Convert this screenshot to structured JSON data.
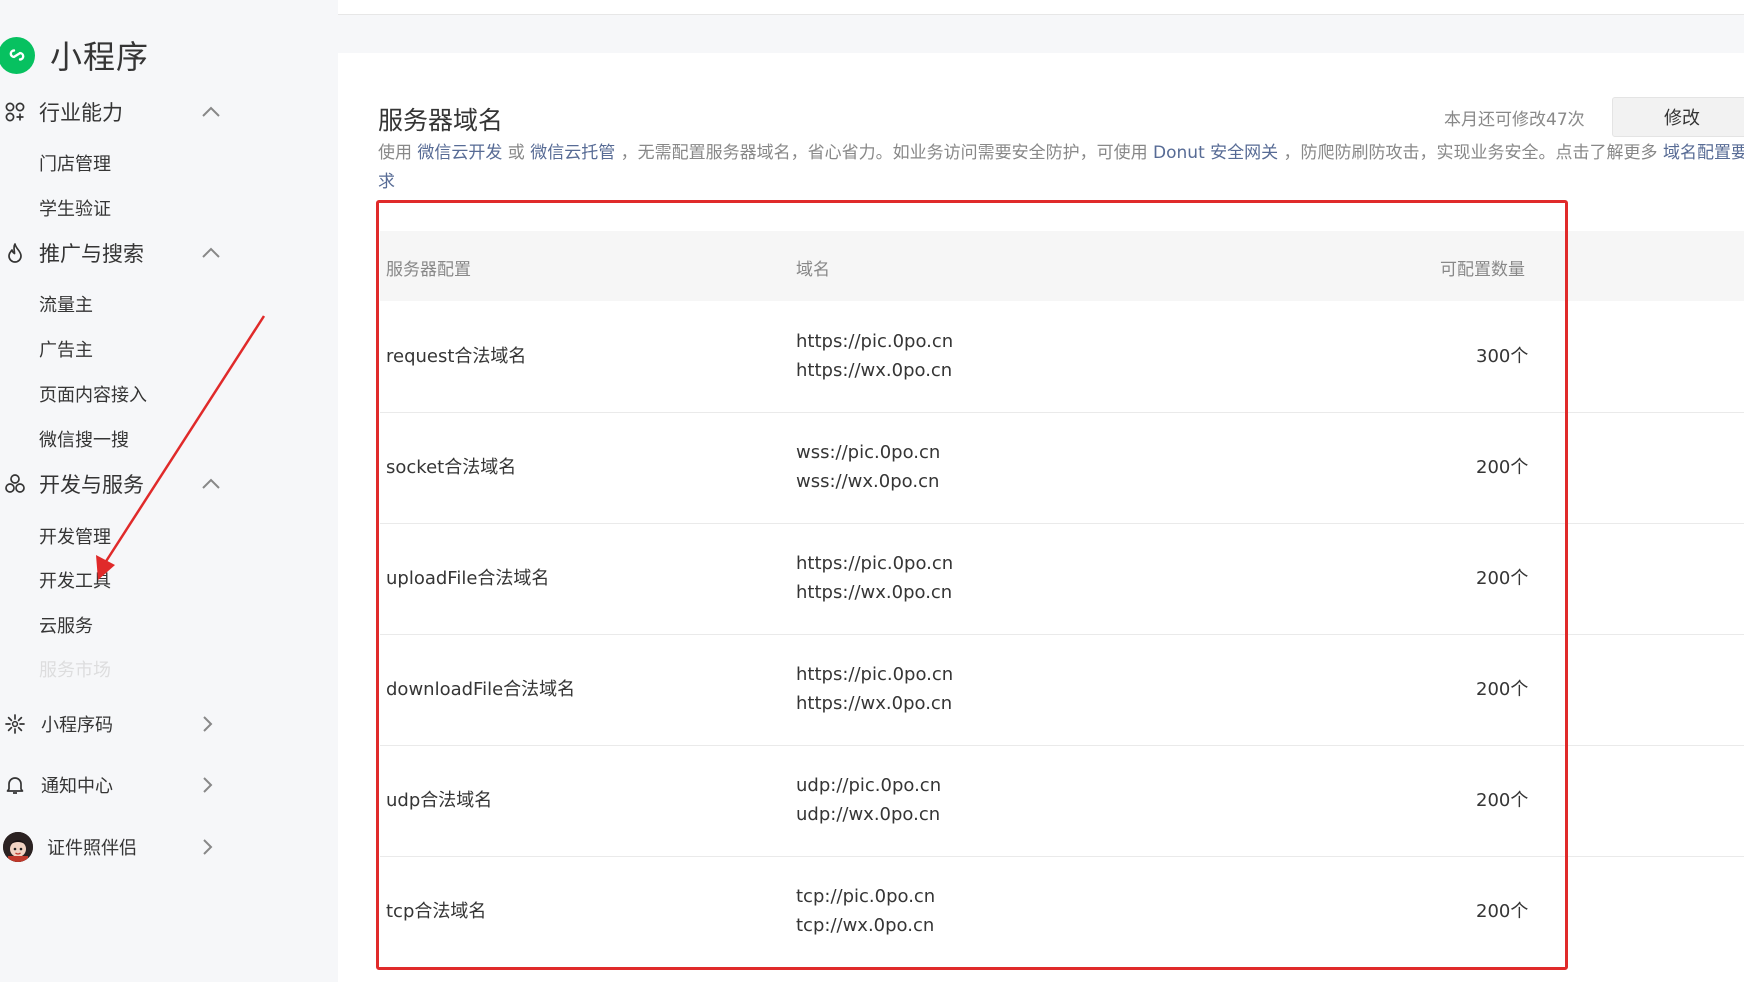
{
  "app": {
    "title": "小程序",
    "brand_color": "#07c160"
  },
  "sidebar": {
    "groups": [
      {
        "icon": "industry-icon",
        "label": "行业能力",
        "expanded": true,
        "items": [
          "门店管理",
          "学生验证"
        ]
      },
      {
        "icon": "flame-icon",
        "label": "推广与搜索",
        "expanded": true,
        "items": [
          "流量主",
          "广告主",
          "页面内容接入",
          "微信搜一搜"
        ]
      },
      {
        "icon": "dev-services-icon",
        "label": "开发与服务",
        "expanded": true,
        "items": [
          "开发管理",
          "开发工具",
          "云服务",
          "服务市场"
        ]
      }
    ],
    "links": [
      {
        "icon": "qrcode-icon",
        "label": "小程序码"
      },
      {
        "icon": "bell-icon",
        "label": "通知中心"
      },
      {
        "icon": "avatar",
        "label": "证件照伴侣"
      }
    ]
  },
  "main": {
    "title": "服务器域名",
    "quota_text": "本月还可修改47次",
    "edit_button": "修改",
    "desc": {
      "p1": "使用 ",
      "link1": "微信云开发",
      "p2": " 或 ",
      "link2": "微信云托管",
      "p3": " ，无需配置服务器域名，省心省力。如业务访问需要安全防护，可使用 ",
      "link3": "Donut 安全网关",
      "p4": " ，防爬防刷防攻击，实现业务安全。点击了解更多 ",
      "link4": "域名配置要求"
    },
    "table": {
      "headers": [
        "服务器配置",
        "域名",
        "可配置数量"
      ],
      "rows": [
        {
          "config": "request合法域名",
          "domains": [
            "https://pic.0po.cn",
            "https://wx.0po.cn"
          ],
          "count": "300个"
        },
        {
          "config": "socket合法域名",
          "domains": [
            "wss://pic.0po.cn",
            "wss://wx.0po.cn"
          ],
          "count": "200个"
        },
        {
          "config": "uploadFile合法域名",
          "domains": [
            "https://pic.0po.cn",
            "https://wx.0po.cn"
          ],
          "count": "200个"
        },
        {
          "config": "downloadFile合法域名",
          "domains": [
            "https://pic.0po.cn",
            "https://wx.0po.cn"
          ],
          "count": "200个"
        },
        {
          "config": "udp合法域名",
          "domains": [
            "udp://pic.0po.cn",
            "udp://wx.0po.cn"
          ],
          "count": "200个"
        },
        {
          "config": "tcp合法域名",
          "domains": [
            "tcp://pic.0po.cn",
            "tcp://wx.0po.cn"
          ],
          "count": "200个"
        }
      ]
    }
  },
  "annotation": {
    "highlight_color": "#e02a2a"
  }
}
